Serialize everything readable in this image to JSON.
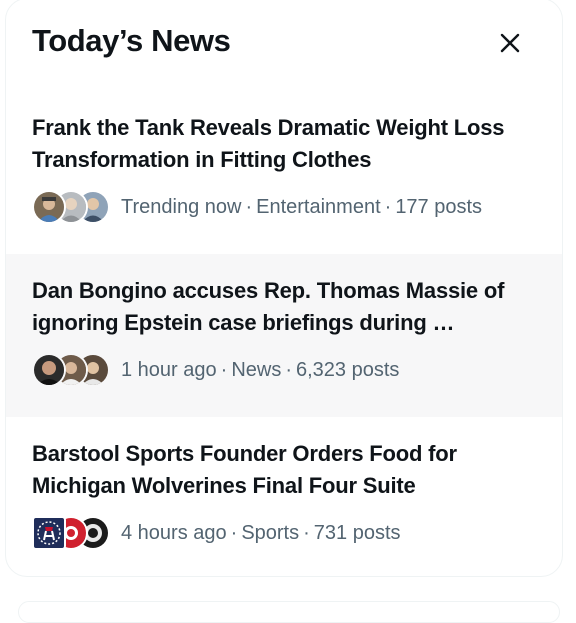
{
  "panel": {
    "title": "Today’s News",
    "close_icon": "close-icon"
  },
  "news": [
    {
      "headline": "Frank the Tank Reveals Dramatic Weight Loss Transformation in Fitting Clothes",
      "time": "Trending now",
      "category": "Entertainment",
      "posts": "177 posts",
      "highlighted": false,
      "avatar_icons": [
        "person-avatar-icon",
        "person-avatar-icon",
        "person-avatar-icon"
      ]
    },
    {
      "headline": "Dan Bongino accuses Rep. Thomas Massie of ignoring Epstein case briefings during …",
      "time": "1 hour ago",
      "category": "News",
      "posts": "6,323 posts",
      "highlighted": true,
      "avatar_icons": [
        "person-avatar-icon",
        "person-avatar-icon",
        "person-avatar-icon"
      ]
    },
    {
      "headline": "Barstool Sports Founder Orders Food for Michigan Wolverines Final Four Suite",
      "time": "4 hours ago",
      "category": "Sports",
      "posts": "731 posts",
      "highlighted": false,
      "avatar_icons": [
        "barstool-logo-icon",
        "red-logo-icon",
        "person-avatar-icon"
      ]
    }
  ],
  "separator": "·",
  "colors": {
    "text_primary": "#0f1419",
    "text_secondary": "#536471",
    "highlight_bg": "#f7f7f8",
    "border": "#eff3f4"
  }
}
